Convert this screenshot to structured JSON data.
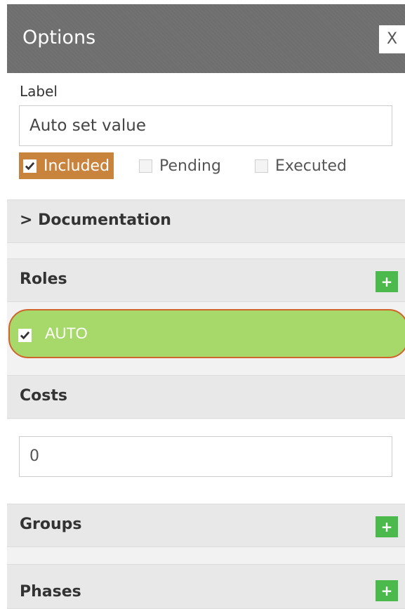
{
  "header": {
    "title": "Options",
    "close_label": "X"
  },
  "label_section": {
    "field_label": "Label",
    "value": "Auto set value",
    "statuses": [
      {
        "label": "Included",
        "checked": true
      },
      {
        "label": "Pending",
        "checked": false
      },
      {
        "label": "Executed",
        "checked": false
      }
    ]
  },
  "documentation": {
    "title": "> Documentation"
  },
  "roles": {
    "title": "Roles",
    "add_label": "+",
    "items": [
      {
        "label": "AUTO",
        "checked": true
      }
    ]
  },
  "costs": {
    "title": "Costs",
    "value": "0"
  },
  "groups": {
    "title": "Groups",
    "add_label": "+"
  },
  "phases": {
    "title": "Phases",
    "add_label": "+"
  },
  "colors": {
    "accent_included": "#c8833c",
    "add_button": "#4cb94c",
    "role_highlight": "#a6d96a",
    "role_outline": "#d0652c",
    "header_bg": "#6e6e6e"
  }
}
